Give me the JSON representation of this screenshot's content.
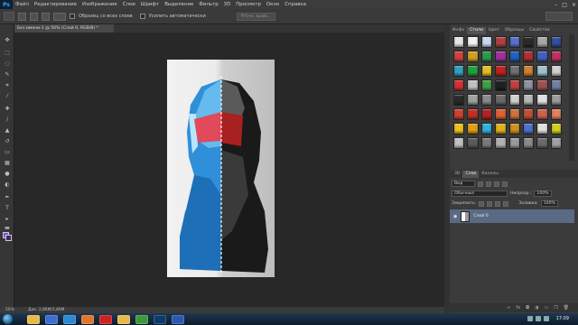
{
  "menu": {
    "logo": "Ps",
    "items": [
      "Файл",
      "Редактирование",
      "Изображение",
      "Слои",
      "Шрифт",
      "Выделение",
      "Фильтр",
      "3D",
      "Просмотр",
      "Окно",
      "Справка"
    ],
    "window_controls": [
      "–",
      "□",
      "×"
    ]
  },
  "options_bar": {
    "sample_all_layers": "Образец со всех слоев",
    "auto_enhance": "Усилить автоматически",
    "refine_edge": "Уточн. край..."
  },
  "document": {
    "tab_title": "Без имени-1 @ 50% (Слой 0, RGB/8) *",
    "status_zoom": "50%",
    "status_doc": "Док: 2,86M/2,86M"
  },
  "panels": {
    "top_tabs": [
      "Инфо",
      "Стили",
      "Цвет",
      "Образцы",
      "Свойства"
    ],
    "active_top_tab": "Стили",
    "layer_tabs": [
      "3D",
      "Слои",
      "Каналы"
    ],
    "active_layer_tab": "Слои",
    "filter_label": "Вид",
    "blend_mode": "Обычные",
    "opacity_label": "Непрозр.:",
    "opacity_value": "100%",
    "lock_label": "Закрепить:",
    "fill_label": "Заливка:",
    "fill_value": "100%",
    "layer_name": "Слой 0"
  },
  "styles_swatches": [
    "#e6e6e6",
    "#f2f2f2",
    "#c8d8f0",
    "#b04040",
    "#5a6fd0",
    "#2a2a2a",
    "#a8a8a8",
    "#3050a0",
    "#d04040",
    "#d0a020",
    "#2a9a50",
    "#a030a0",
    "#2060c0",
    "#b03030",
    "#4060c0",
    "#c03060",
    "#30a0c0",
    "#20a040",
    "#e0c020",
    "#c02020",
    "#707070",
    "#d08030",
    "#a0c0d0",
    "#d0d0d0",
    "#d03030",
    "#c0c0c0",
    "#40a040",
    "#202020",
    "#c04040",
    "#9090a0",
    "#a05050",
    "#7080a0",
    "#2a2a2a",
    "#a0a0a0",
    "#8a8a8a",
    "#6a6a6a",
    "#d0d0d0",
    "#b8b8b8",
    "#e0e0e0",
    "#9a9a9a",
    "#d04030",
    "#c03020",
    "#b82020",
    "#e06030",
    "#d07040",
    "#c05030",
    "#d06050",
    "#e08060",
    "#f0c020",
    "#e0a010",
    "#30b0e0",
    "#e0b020",
    "#d09020",
    "#5070d0",
    "#e0e0e0",
    "#d0d020",
    "#c0c0c0",
    "#5a5a5a",
    "#7a7a7a",
    "#b0b0b0",
    "#9a9a9a",
    "#8a8a8a",
    "#6a6a6a",
    "#a0a0a0"
  ],
  "statusbar_labels": {
    "zoom": "50%",
    "doc": "Док: 2,86M/2,86M"
  },
  "taskbar": {
    "icons": [
      "explorer",
      "media",
      "ie",
      "firefox",
      "opera",
      "folder",
      "chrome",
      "photoshop",
      "word"
    ],
    "icon_colors": [
      "#e8b84a",
      "#3b6fcf",
      "#2a8ad6",
      "#e0762a",
      "#d02020",
      "#e8b84a",
      "#3a9a3a",
      "#0d3a6a",
      "#2a5ab0"
    ],
    "clock": "17:09"
  },
  "toolbox_icons": [
    "move",
    "marquee",
    "lasso",
    "quick-select",
    "crop",
    "eyedropper",
    "heal",
    "brush",
    "stamp",
    "history",
    "eraser",
    "gradient",
    "blur",
    "dodge",
    "pen",
    "type",
    "path-select",
    "shape",
    "hand",
    "zoom"
  ]
}
